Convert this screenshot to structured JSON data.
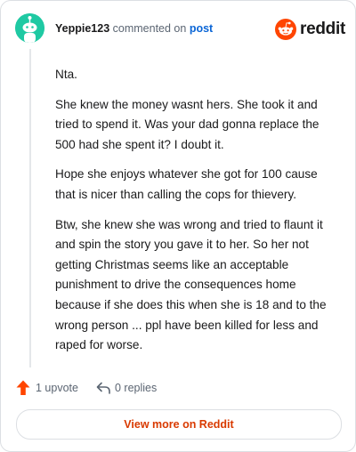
{
  "header": {
    "username": "Yeppie123",
    "action_text": "commented on",
    "post_link": "post",
    "logo_text": "reddit"
  },
  "comment": {
    "paragraphs": [
      "Nta.",
      "She knew the money wasnt hers. She took it and tried to spend it. Was your dad gonna replace the 500 had she spent it? I doubt it.",
      "Hope she enjoys whatever she got for 100 cause that is nicer than calling the cops for thievery.",
      "Btw, she knew she was wrong and tried to flaunt it and spin the story you gave it to her. So her not getting Christmas seems like an acceptable punishment to drive the consequences home because if she does this when she is 18 and to the wrong person ... ppl have been killed for less and raped for worse."
    ]
  },
  "actions": {
    "upvote_label": "1 upvote",
    "replies_label": "0 replies"
  },
  "footer": {
    "view_more_label": "View more on Reddit"
  },
  "colors": {
    "avatar": "#1fc9a3",
    "reddit_orange": "#ff4500",
    "link_blue": "#0b66d6",
    "button_text": "#d93a00"
  },
  "icons": [
    "snoo-avatar-icon",
    "reddit-logo-icon",
    "upvote-arrow-icon",
    "reply-arrow-icon"
  ]
}
